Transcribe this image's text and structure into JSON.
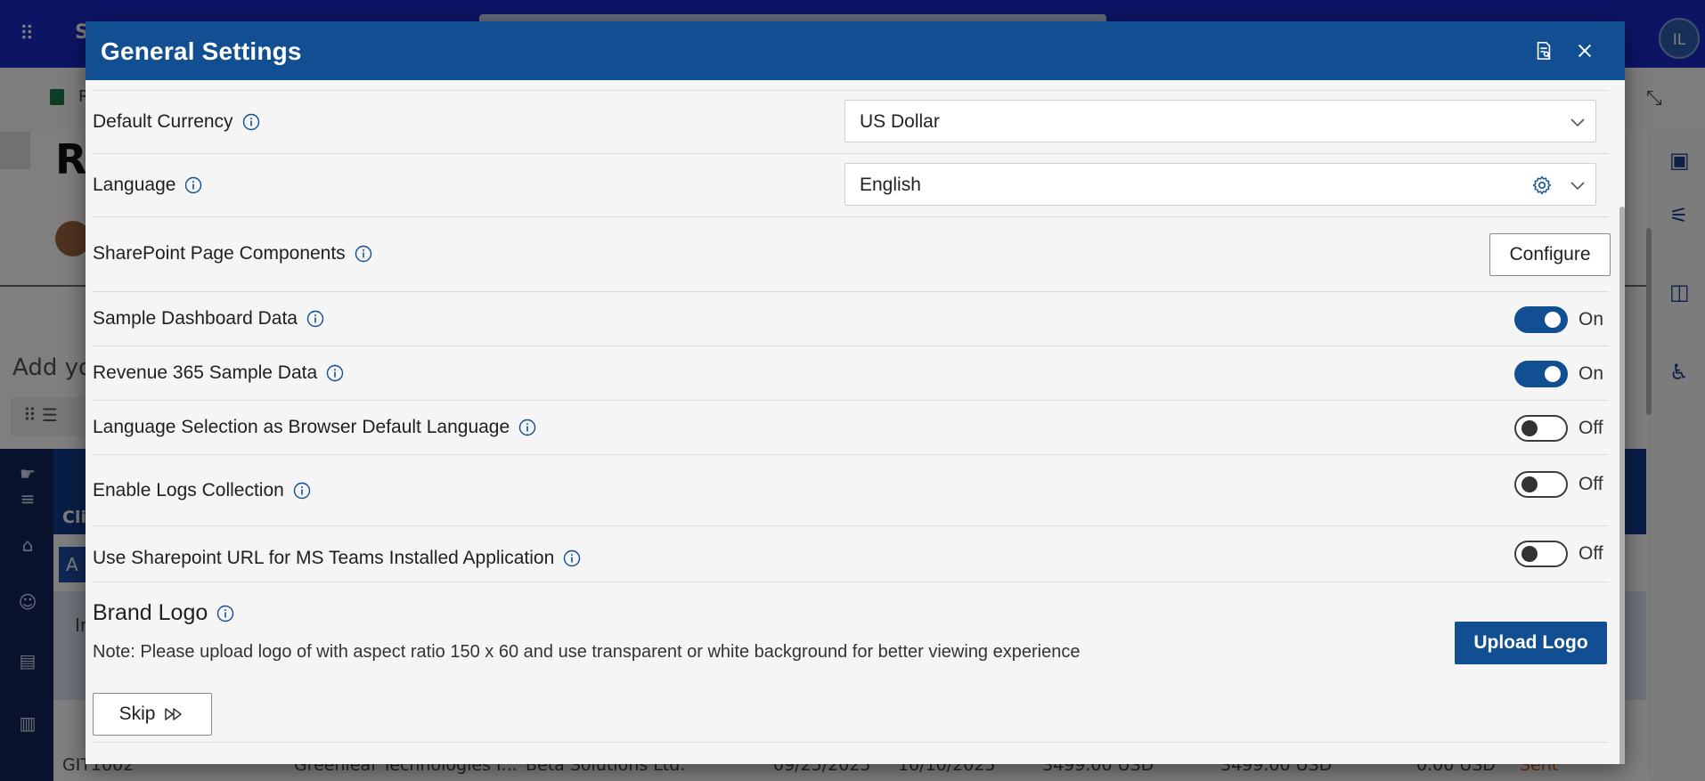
{
  "background": {
    "app_initial": "S",
    "avatar_initials": "IL",
    "site_letter": "R",
    "page_title_fragment": "Re",
    "add_text_fragment": "Add yo",
    "client_fragment": "Cli",
    "row2_fragment": "A",
    "in_fragment": "In",
    "table_row": {
      "id": "GIT1002",
      "client": "Greenleaf Technologies I...",
      "company": "Beta Solutions Ltd.",
      "date1": "09/25/2025",
      "date2": "10/10/2025",
      "amount1": "3499.00 USD",
      "amount2": "3499.00 USD",
      "amount3": "0.00 USD",
      "status": "Sent"
    }
  },
  "dialog": {
    "title": "General Settings",
    "header_icons": [
      "report-icon",
      "close-icon"
    ],
    "settings": {
      "default_currency": {
        "label": "Default Currency",
        "value": "US Dollar"
      },
      "language": {
        "label": "Language",
        "value": "English"
      },
      "sharepoint_components": {
        "label": "SharePoint Page Components",
        "button": "Configure"
      },
      "sample_dashboard": {
        "label": "Sample Dashboard Data",
        "state": "On"
      },
      "revenue_sample": {
        "label": "Revenue 365 Sample Data",
        "state": "On"
      },
      "browser_language": {
        "label": "Language Selection as Browser Default Language",
        "state": "Off"
      },
      "logs_collection": {
        "label": "Enable Logs Collection",
        "state": "Off"
      },
      "sharepoint_url": {
        "label": "Use Sharepoint URL for MS Teams Installed Application",
        "state": "Off"
      }
    },
    "brand_logo": {
      "title": "Brand Logo",
      "note": "Note: Please upload logo of with aspect ratio 150 x 60 and use transparent or white background for better viewing experience",
      "upload_button": "Upload Logo"
    },
    "skip_button": "Skip"
  },
  "colors": {
    "header_blue": "#124e92",
    "toggle_on": "#124e92",
    "accent_text": "#1f1f1f"
  }
}
